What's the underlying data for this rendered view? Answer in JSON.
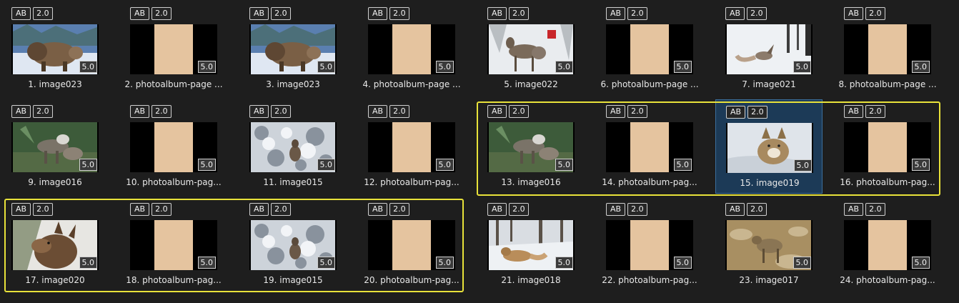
{
  "badges": {
    "ab": "AB",
    "version": "2.0",
    "duration": "5.0"
  },
  "colors": {
    "group_outline": "#e8e23a",
    "selection_fill": "#1c3a57",
    "page_paper": "#e5c49f"
  },
  "tiles": [
    {
      "label": "1. image023",
      "kind": "photo",
      "subject": "bison"
    },
    {
      "label": "2. photoalbum-page ...",
      "kind": "page"
    },
    {
      "label": "3. image023",
      "kind": "photo",
      "subject": "bison"
    },
    {
      "label": "4. photoalbum-page ...",
      "kind": "page"
    },
    {
      "label": "5. image022",
      "kind": "photo",
      "subject": "deer-snow"
    },
    {
      "label": "6. photoalbum-page ...",
      "kind": "page"
    },
    {
      "label": "7. image021",
      "kind": "photo",
      "subject": "fox-snow"
    },
    {
      "label": "8. photoalbum-page ...",
      "kind": "page"
    },
    {
      "label": "9. image016",
      "kind": "photo",
      "subject": "sheep"
    },
    {
      "label": "10. photoalbum-pag...",
      "kind": "page"
    },
    {
      "label": "11. image015",
      "kind": "photo",
      "subject": "deer-forest"
    },
    {
      "label": "12. photoalbum-pag...",
      "kind": "page"
    },
    {
      "label": "13. image016",
      "kind": "photo",
      "subject": "sheep"
    },
    {
      "label": "14. photoalbum-pag...",
      "kind": "page"
    },
    {
      "label": "15. image019",
      "kind": "photo",
      "subject": "coyote",
      "selected": true
    },
    {
      "label": "16. photoalbum-pag...",
      "kind": "page"
    },
    {
      "label": "17. image020",
      "kind": "photo",
      "subject": "elk"
    },
    {
      "label": "18. photoalbum-pag...",
      "kind": "page"
    },
    {
      "label": "19. image015",
      "kind": "photo",
      "subject": "deer-forest"
    },
    {
      "label": "20. photoalbum-pag...",
      "kind": "page"
    },
    {
      "label": "21. image018",
      "kind": "photo",
      "subject": "fox-lying"
    },
    {
      "label": "22. photoalbum-pag...",
      "kind": "page"
    },
    {
      "label": "23. image017",
      "kind": "photo",
      "subject": "coyote-rocks"
    },
    {
      "label": "24. photoalbum-pag...",
      "kind": "page"
    }
  ]
}
